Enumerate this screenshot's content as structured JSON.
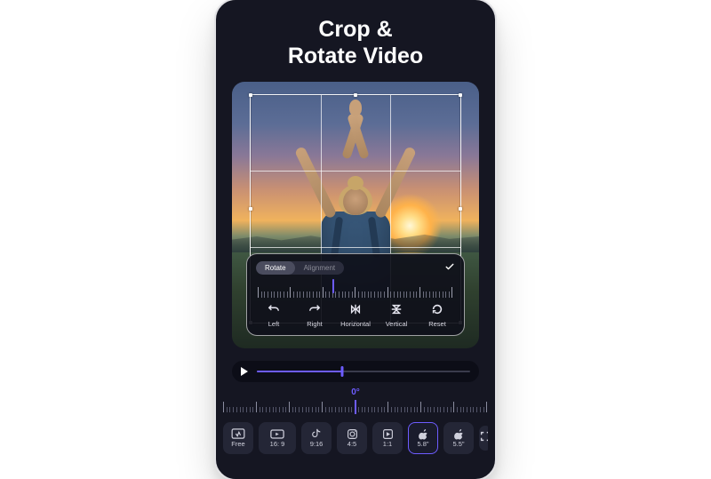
{
  "hero": {
    "line1": "Crop &",
    "line2": "Rotate Video"
  },
  "rotate_card": {
    "tabs": {
      "rotate": "Rotate",
      "alignment": "Alignment",
      "active": "rotate"
    },
    "confirm_icon": "check-icon",
    "dial_position_pct": 38,
    "actions": [
      {
        "key": "left",
        "label": "Left",
        "icon": "rotate-left-icon"
      },
      {
        "key": "right",
        "label": "Right",
        "icon": "rotate-right-icon"
      },
      {
        "key": "horizontal",
        "label": "Horizontal",
        "icon": "flip-horizontal-icon"
      },
      {
        "key": "vertical",
        "label": "Vertical",
        "icon": "flip-vertical-icon"
      },
      {
        "key": "reset",
        "label": "Reset",
        "icon": "reset-icon"
      }
    ]
  },
  "playback": {
    "progress_pct": 40
  },
  "ruler": {
    "center_label": "0°"
  },
  "ratios": {
    "selected": "5.8",
    "items": [
      {
        "key": "free",
        "label": "Free",
        "icon": "free-crop-icon"
      },
      {
        "key": "16_9",
        "label": "16: 9",
        "icon": "ratio-16-9-icon"
      },
      {
        "key": "tiktok",
        "label": "9:16",
        "icon": "tiktok-icon"
      },
      {
        "key": "4_5",
        "label": "4:5",
        "icon": "instagram-icon"
      },
      {
        "key": "1_1",
        "label": "1:1",
        "icon": "ratio-1-1-icon"
      },
      {
        "key": "5.8",
        "label": "5.8\"",
        "icon": "apple-icon"
      },
      {
        "key": "5.5",
        "label": "5.5\"",
        "icon": "apple-icon"
      }
    ]
  },
  "fullscreen": {
    "icon": "fullscreen-icon"
  },
  "colors": {
    "accent": "#6d5cff"
  }
}
